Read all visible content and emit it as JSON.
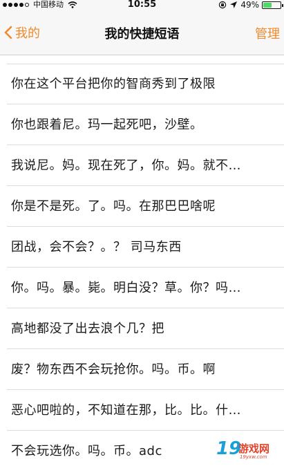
{
  "status_bar": {
    "carrier": "中国移动",
    "time": "10:55",
    "battery": "49%",
    "battery_level": 0.49,
    "icons": [
      "signal-dots",
      "wifi-icon",
      "lock-rotation-icon",
      "location-arrow-icon",
      "battery-icon"
    ]
  },
  "nav": {
    "back_label": "我的",
    "title": "我的快捷短语",
    "manage_label": "管理",
    "accent_color": "#f08a2c"
  },
  "phrases": [
    "你在这个平台把你的智商秀到了极限",
    "你也跟着尼。玛一起死吧，沙壁。",
    "我说尼。妈。现在死了，你。妈。就不…",
    "你是不是死。了。吗。在那巴巴啥呢",
    "团战，会不会？。？ 司马东西",
    "你。吗。暴。毙。明白没？草。你？吗…",
    "高地都没了出去浪个几？把",
    "废？物东西不会玩抢你。吗。币。啊",
    "恶心吧啦的，不知道在那，比。比。什…",
    "不会玩选你。吗。币。adc"
  ],
  "watermark": {
    "number": "19",
    "name": "游戏网",
    "sub": "19yxw.com"
  }
}
